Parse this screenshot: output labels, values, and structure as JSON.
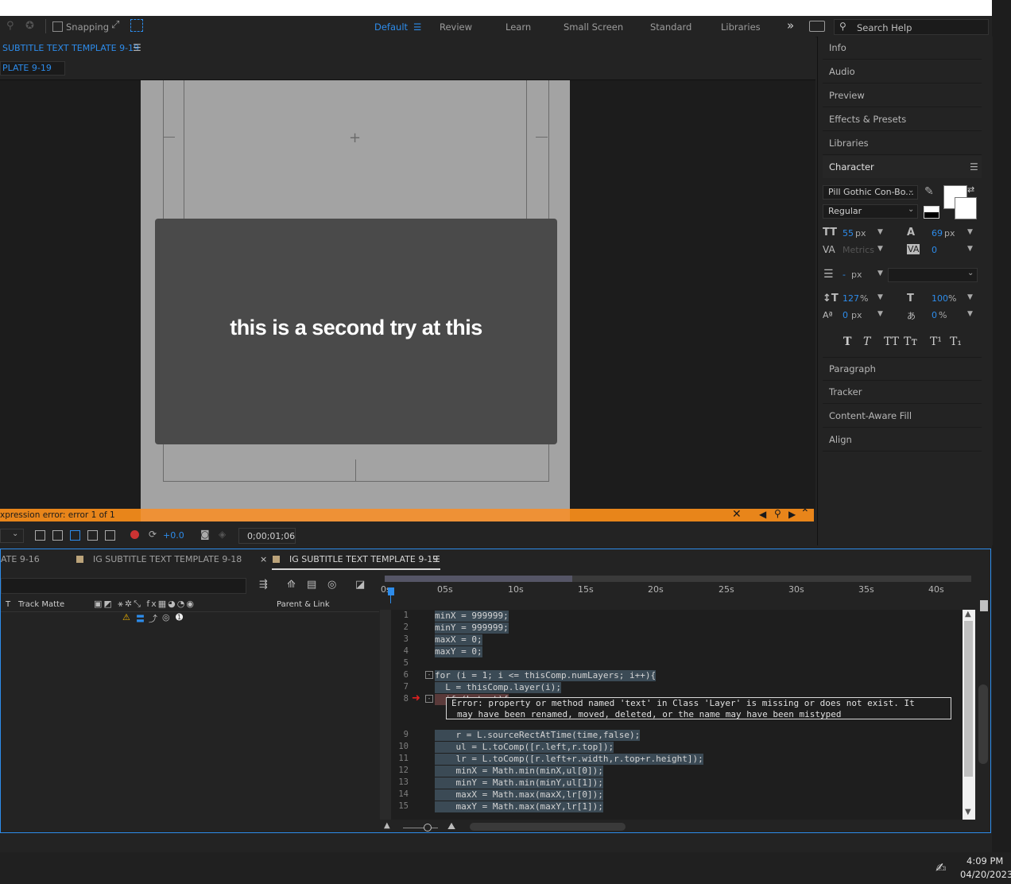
{
  "toolbar": {
    "snapping_label": "Snapping",
    "workspaces": [
      "Default",
      "Review",
      "Learn",
      "Small Screen",
      "Standard",
      "Libraries"
    ],
    "more_glyph": "»",
    "search_placeholder": "Search Help"
  },
  "comp": {
    "panel_title": "SUBTITLE TEXT TEMPLATE 9-19",
    "tab_label": "PLATE 9-19",
    "subtitle_text": "this is a second try at this",
    "error_message": "xpression error: error 1 of 1",
    "exposure_value": "+0.0",
    "timecode": "0;00;01;06"
  },
  "right_panel": {
    "items": [
      "Info",
      "Audio",
      "Preview",
      "Effects & Presets",
      "Libraries"
    ],
    "character": {
      "title": "Character",
      "font_family": "Pill Gothic Con-Bo...",
      "font_style": "Regular",
      "font_size": "55",
      "leading": "69",
      "kerning": "Metrics",
      "tracking": "0",
      "stroke_width": "-",
      "vertical_scale": "127",
      "horizontal_scale": "100",
      "baseline_shift": "0",
      "tsume": "0",
      "unit_px": "px",
      "unit_pct": "%",
      "style_buttons": [
        "T",
        "T",
        "TT",
        "Tт",
        "T¹",
        "T₁"
      ]
    },
    "items_below": [
      "Paragraph",
      "Tracker",
      "Content-Aware Fill",
      "Align"
    ]
  },
  "timeline": {
    "tabs": [
      "ATE 9-16",
      "IG SUBTITLE TEXT TEMPLATE 9-18",
      "IG SUBTITLE TEXT TEMPLATE 9-19"
    ],
    "close_glyph": "×",
    "col_t": "T",
    "col_track_matte": "Track Matte",
    "col_parent": "Parent & Link",
    "ruler_labels": [
      "0s",
      "05s",
      "10s",
      "15s",
      "20s",
      "25s",
      "30s",
      "35s",
      "40s"
    ],
    "code_lines": [
      {
        "n": "1",
        "text": "minX = 999999;"
      },
      {
        "n": "2",
        "text": "minY = 999999;"
      },
      {
        "n": "3",
        "text": "maxX = 0;"
      },
      {
        "n": "4",
        "text": "maxY = 0;"
      },
      {
        "n": "5",
        "text": ""
      },
      {
        "n": "6",
        "text": "for (i = 1; i <= thisComp.numLayers; i++){"
      },
      {
        "n": "7",
        "text": "  L = thisComp.layer(i);"
      },
      {
        "n": "8",
        "text": "  if (L.text){"
      },
      {
        "n": "9",
        "text": "    r = L.sourceRectAtTime(time,false);"
      },
      {
        "n": "10",
        "text": "    ul = L.toComp([r.left,r.top]);"
      },
      {
        "n": "11",
        "text": "    lr = L.toComp([r.left+r.width,r.top+r.height]);"
      },
      {
        "n": "12",
        "text": "    minX = Math.min(minX,ul[0]);"
      },
      {
        "n": "13",
        "text": "    minY = Math.min(minY,ul[1]);"
      },
      {
        "n": "14",
        "text": "    maxX = Math.max(maxX,lr[0]);"
      },
      {
        "n": "15",
        "text": "    maxY = Math.max(maxY,lr[1]);"
      }
    ],
    "error_line1": "Error:  property or method named 'text' in Class 'Layer' is missing or does not exist. It",
    "error_line2": "may have been renamed, moved, deleted, or the name may have been mistyped"
  },
  "taskbar": {
    "time": "4:09 PM",
    "date": "04/20/2023"
  },
  "colors": {
    "accent": "#2d8ceb",
    "error_bar": "#e8851a",
    "panel_bg": "#232323"
  }
}
